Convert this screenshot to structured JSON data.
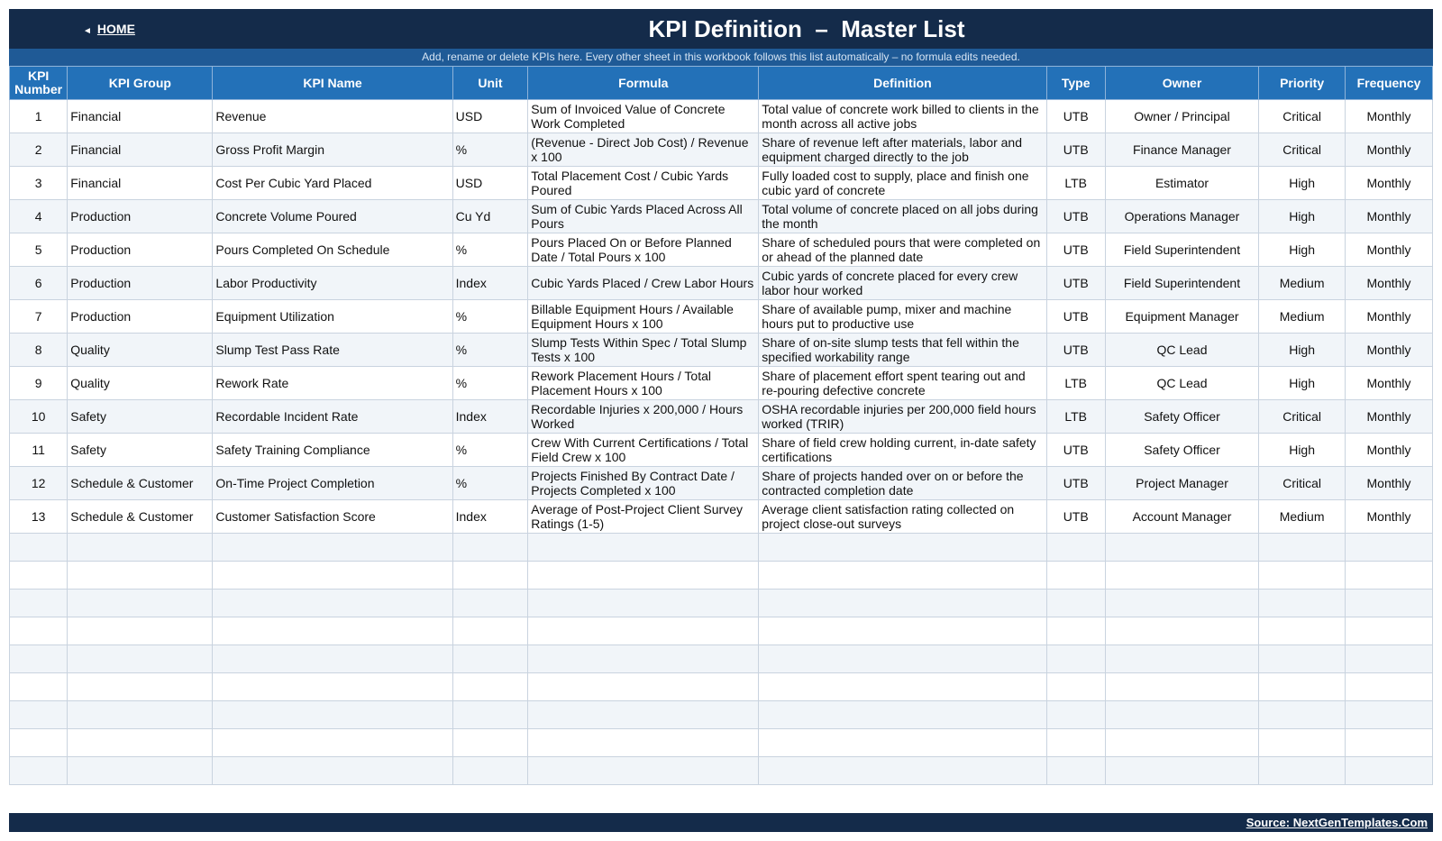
{
  "header": {
    "home_label": "HOME",
    "title": "KPI Definition  –  Master List",
    "subtitle": "Add, rename or delete KPIs here. Every other sheet in this workbook follows this list automatically – no formula edits needed."
  },
  "table": {
    "columns": [
      "KPI Number",
      "KPI Group",
      "KPI Name",
      "Unit",
      "Formula",
      "Definition",
      "Type",
      "Owner",
      "Priority",
      "Frequency"
    ],
    "rows": [
      [
        "1",
        "Financial",
        "Revenue",
        "USD",
        "Sum of Invoiced Value of Concrete Work Completed",
        "Total value of concrete work billed to clients in the month across all active jobs",
        "UTB",
        "Owner / Principal",
        "Critical",
        "Monthly"
      ],
      [
        "2",
        "Financial",
        "Gross Profit Margin",
        "%",
        "(Revenue - Direct Job Cost) / Revenue x 100",
        "Share of revenue left after materials, labor and equipment charged directly to the job",
        "UTB",
        "Finance Manager",
        "Critical",
        "Monthly"
      ],
      [
        "3",
        "Financial",
        "Cost Per Cubic Yard Placed",
        "USD",
        "Total Placement Cost / Cubic Yards Poured",
        "Fully loaded cost to supply, place and finish one cubic yard of concrete",
        "LTB",
        "Estimator",
        "High",
        "Monthly"
      ],
      [
        "4",
        "Production",
        "Concrete Volume Poured",
        "Cu Yd",
        "Sum of Cubic Yards Placed Across All Pours",
        "Total volume of concrete placed on all jobs during the month",
        "UTB",
        "Operations Manager",
        "High",
        "Monthly"
      ],
      [
        "5",
        "Production",
        "Pours Completed On Schedule",
        "%",
        "Pours Placed On or Before Planned Date / Total Pours x 100",
        "Share of scheduled pours that were completed on or ahead of the planned date",
        "UTB",
        "Field Superintendent",
        "High",
        "Monthly"
      ],
      [
        "6",
        "Production",
        "Labor Productivity",
        "Index",
        "Cubic Yards Placed / Crew Labor Hours",
        "Cubic yards of concrete placed for every crew labor hour worked",
        "UTB",
        "Field Superintendent",
        "Medium",
        "Monthly"
      ],
      [
        "7",
        "Production",
        "Equipment Utilization",
        "%",
        "Billable Equipment Hours / Available Equipment Hours x 100",
        "Share of available pump, mixer and machine hours put to productive use",
        "UTB",
        "Equipment Manager",
        "Medium",
        "Monthly"
      ],
      [
        "8",
        "Quality",
        "Slump Test Pass Rate",
        "%",
        "Slump Tests Within Spec / Total Slump Tests x 100",
        "Share of on-site slump tests that fell within the specified workability range",
        "UTB",
        "QC Lead",
        "High",
        "Monthly"
      ],
      [
        "9",
        "Quality",
        "Rework Rate",
        "%",
        "Rework Placement Hours / Total Placement Hours x 100",
        "Share of placement effort spent tearing out and re-pouring defective concrete",
        "LTB",
        "QC Lead",
        "High",
        "Monthly"
      ],
      [
        "10",
        "Safety",
        "Recordable Incident Rate",
        "Index",
        "Recordable Injuries x 200,000 / Hours Worked",
        "OSHA recordable injuries per 200,000 field hours worked (TRIR)",
        "LTB",
        "Safety Officer",
        "Critical",
        "Monthly"
      ],
      [
        "11",
        "Safety",
        "Safety Training Compliance",
        "%",
        "Crew With Current Certifications / Total Field Crew x 100",
        "Share of field crew holding current, in-date safety certifications",
        "UTB",
        "Safety Officer",
        "High",
        "Monthly"
      ],
      [
        "12",
        "Schedule & Customer",
        "On-Time Project Completion",
        "%",
        "Projects Finished By Contract Date / Projects Completed x 100",
        "Share of projects handed over on or before the contracted completion date",
        "UTB",
        "Project Manager",
        "Critical",
        "Monthly"
      ],
      [
        "13",
        "Schedule & Customer",
        "Customer Satisfaction Score",
        "Index",
        "Average of Post-Project Client Survey Ratings (1-5)",
        "Average client satisfaction rating collected on project close-out surveys",
        "UTB",
        "Account Manager",
        "Medium",
        "Monthly"
      ]
    ],
    "empty_rows": 9
  },
  "footer": {
    "source": "Source: NextGenTemplates.Com"
  },
  "colors": {
    "header_bg": "#142b4a",
    "subtitle_bg": "#1f5a96",
    "column_header_bg": "#2371b8"
  }
}
